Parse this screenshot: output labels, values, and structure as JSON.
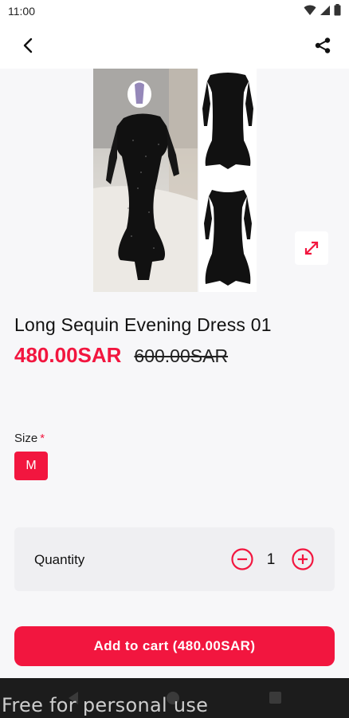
{
  "status_bar": {
    "time": "11:00"
  },
  "product": {
    "title": "Long Sequin Evening Dress 01",
    "price_current": "480.00SAR",
    "price_old": "600.00SAR"
  },
  "size": {
    "label": "Size",
    "required_mark": "*",
    "options": [
      "M"
    ],
    "selected": "M"
  },
  "quantity": {
    "label": "Quantity",
    "value": "1"
  },
  "actions": {
    "add_to_cart_label": "Add to cart (480.00SAR)"
  },
  "watermark": "Free for personal use",
  "colors": {
    "accent": "#f2163f",
    "background": "#f7f7f9",
    "card": "#efeff2"
  },
  "icons": {
    "back": "arrow-left-icon",
    "share": "share-icon",
    "expand": "expand-icon",
    "minus": "minus-circle-icon",
    "plus": "plus-circle-icon"
  }
}
